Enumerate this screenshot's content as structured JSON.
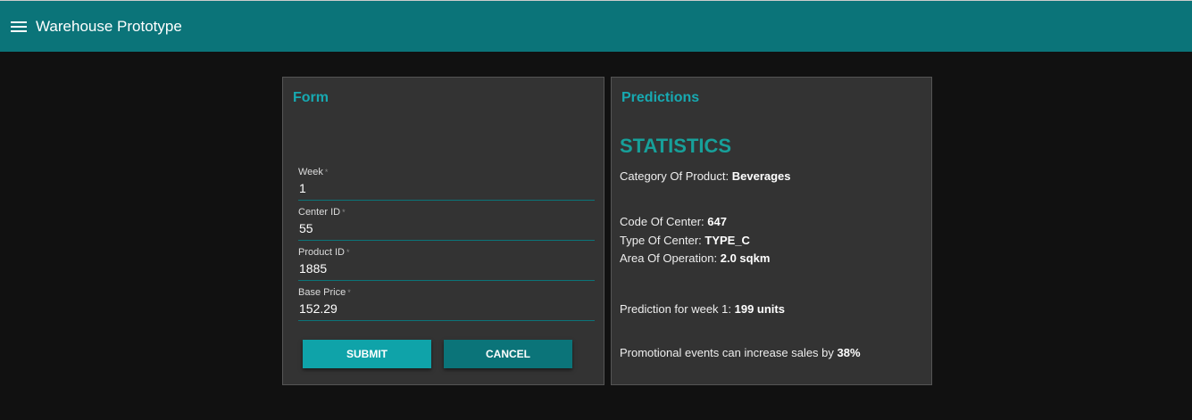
{
  "app": {
    "title": "Warehouse Prototype"
  },
  "form": {
    "heading": "Form",
    "fields": [
      {
        "label": "Week",
        "value": "1"
      },
      {
        "label": "Center ID",
        "value": "55"
      },
      {
        "label": "Product ID",
        "value": "1885"
      },
      {
        "label": "Base Price",
        "value": "152.29"
      }
    ],
    "required_marker": "*",
    "submit_label": "SUBMIT",
    "cancel_label": "CANCEL"
  },
  "predictions": {
    "heading": "Predictions",
    "stats_title": "STATISTICS",
    "category_label": "Category Of Product: ",
    "category": "Beverages",
    "center_code_label": "Code Of Center: ",
    "center_code": "647",
    "center_type_label": "Type Of Center: ",
    "center_type": "TYPE_C",
    "area_label": "Area Of Operation: ",
    "area": "2.0 sqkm",
    "prediction_label": "Prediction for week 1: ",
    "prediction": "199 units",
    "promo_label": "Promotional events can increase sales by ",
    "promo": "38%"
  }
}
